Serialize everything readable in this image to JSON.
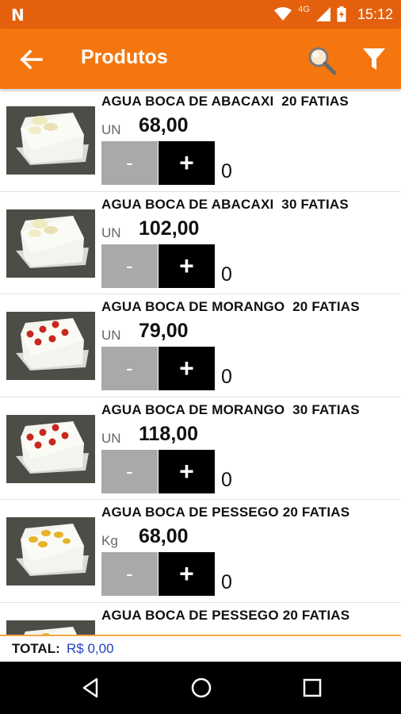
{
  "status_bar": {
    "network": "4G",
    "time": "15:12"
  },
  "app_bar": {
    "title": "Produtos"
  },
  "products": [
    {
      "name": "AGUA BOCA DE ABACAXI  20 FATIAS",
      "unit": "UN",
      "price": "68,00",
      "qty": "0",
      "minus": "-",
      "plus": "+",
      "topping": "abacaxi"
    },
    {
      "name": "AGUA BOCA DE ABACAXI  30 FATIAS",
      "unit": "UN",
      "price": "102,00",
      "qty": "0",
      "minus": "-",
      "plus": "+",
      "topping": "abacaxi"
    },
    {
      "name": "AGUA BOCA DE MORANGO  20 FATIAS",
      "unit": "UN",
      "price": "79,00",
      "qty": "0",
      "minus": "-",
      "plus": "+",
      "topping": "morango"
    },
    {
      "name": "AGUA BOCA DE MORANGO  30 FATIAS",
      "unit": "UN",
      "price": "118,00",
      "qty": "0",
      "minus": "-",
      "plus": "+",
      "topping": "morango"
    },
    {
      "name": "AGUA BOCA DE PESSEGO 20 FATIAS",
      "unit": "Kg",
      "price": "68,00",
      "qty": "0",
      "minus": "-",
      "plus": "+",
      "topping": "pessego"
    },
    {
      "name": "AGUA BOCA DE PESSEGO 20 FATIAS",
      "unit": "",
      "price": "",
      "qty": "",
      "minus": "",
      "plus": "",
      "topping": "pessego"
    }
  ],
  "total": {
    "label": "TOTAL:",
    "value": "R$ 0,00"
  },
  "icons": {
    "back": "arrow-left-icon",
    "search": "search-icon",
    "filter": "filter-icon",
    "nav_back": "triangle-back-icon",
    "nav_home": "circle-home-icon",
    "nav_recents": "square-recents-icon"
  },
  "colors": {
    "status_bar": "#e4600d",
    "app_bar": "#f5760f",
    "minus_button": "#a9a9a9",
    "plus_button": "#000000",
    "total_value": "#2342c2"
  }
}
